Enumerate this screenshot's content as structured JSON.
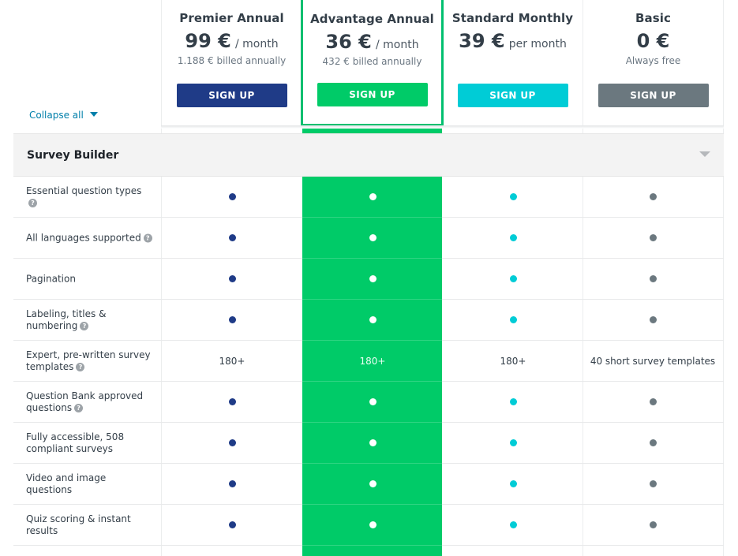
{
  "colors": {
    "premier": "#1f3b87",
    "advantage": "#00bf6f",
    "standard": "#00ccd6",
    "basic": "#6b787f",
    "highlight_column": "#00cb68"
  },
  "controls": {
    "collapse_all": "Collapse all",
    "collapse_icon": "caret-down-icon"
  },
  "plans": [
    {
      "id": "premier",
      "name": "Premier Annual",
      "price": "99 €",
      "period": "/ month",
      "billed": "1.188 € billed annually",
      "signup": "SIGN UP"
    },
    {
      "id": "advantage",
      "name": "Advantage Annual",
      "price": "36 €",
      "period": "/ month",
      "billed": "432 € billed annually",
      "signup": "SIGN UP"
    },
    {
      "id": "standard",
      "name": "Standard Monthly",
      "price": "39 €",
      "period": "per month",
      "billed": "",
      "signup": "SIGN UP"
    },
    {
      "id": "basic",
      "name": "Basic",
      "price": "0 €",
      "period": "",
      "billed": "Always free",
      "signup": "SIGN UP"
    }
  ],
  "section": {
    "title": "Survey Builder",
    "toggle_icon": "chevron-down-icon"
  },
  "features": [
    {
      "label": "Essential question types",
      "help": true,
      "values": [
        "dot",
        "dot",
        "dot",
        "dot"
      ]
    },
    {
      "label": "All languages supported",
      "help": true,
      "values": [
        "dot",
        "dot",
        "dot",
        "dot"
      ]
    },
    {
      "label": "Pagination",
      "help": false,
      "values": [
        "dot",
        "dot",
        "dot",
        "dot"
      ]
    },
    {
      "label": "Labeling, titles & numbering",
      "help": true,
      "values": [
        "dot",
        "dot",
        "dot",
        "dot"
      ]
    },
    {
      "label": "Expert, pre-written survey templates",
      "help": true,
      "values": [
        "180+",
        "180+",
        "180+",
        "40 short survey templates"
      ]
    },
    {
      "label": "Question Bank approved questions",
      "help": true,
      "values": [
        "dot",
        "dot",
        "dot",
        "dot"
      ]
    },
    {
      "label": "Fully accessible, 508 compliant surveys",
      "help": false,
      "values": [
        "dot",
        "dot",
        "dot",
        "dot"
      ]
    },
    {
      "label": "Video and image questions",
      "help": false,
      "values": [
        "dot",
        "dot",
        "dot",
        "dot"
      ]
    },
    {
      "label": "Quiz scoring & instant results",
      "help": false,
      "values": [
        "dot",
        "dot",
        "dot",
        "dot"
      ]
    }
  ],
  "help_glyph": "?"
}
